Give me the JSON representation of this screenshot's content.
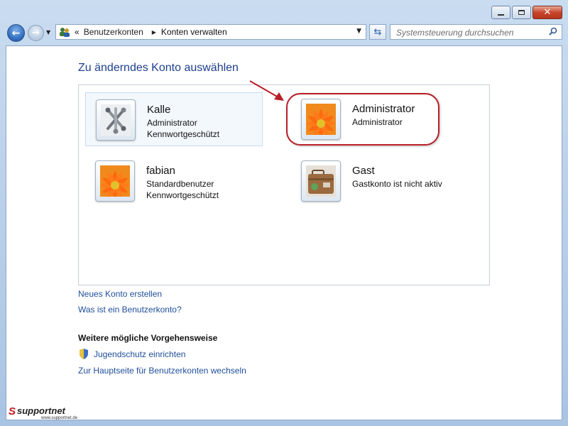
{
  "window": {
    "controls": {
      "minimize": "minimize",
      "maximize": "maximize",
      "close": "close"
    }
  },
  "navbar": {
    "breadcrumb_prefix": "«",
    "breadcrumb": [
      "Benutzerkonten",
      "Konten verwalten"
    ],
    "search_placeholder": "Systemsteuerung durchsuchen"
  },
  "main": {
    "title": "Zu änderndes Konto auswählen",
    "accounts": [
      {
        "name": "Kalle",
        "lines": [
          "Administrator",
          "Kennwortgeschützt"
        ],
        "picture": "jacks-icon",
        "selected": true
      },
      {
        "name": "Administrator",
        "lines": [
          "Administrator"
        ],
        "picture": "flower-icon",
        "highlighted": true
      },
      {
        "name": "fabian",
        "lines": [
          "Standardbenutzer",
          "Kennwortgeschützt"
        ],
        "picture": "flower-icon"
      },
      {
        "name": "Gast",
        "lines": [
          "Gastkonto ist nicht aktiv"
        ],
        "picture": "suitcase-icon"
      }
    ],
    "links": {
      "new_account": "Neues Konto erstellen",
      "what_is": "Was ist ein Benutzerkonto?"
    },
    "further": {
      "heading": "Weitere mögliche Vorgehensweise",
      "parental": "Jugendschutz einrichten",
      "mainpage": "Zur Hauptseite für Benutzerkonten wechseln"
    }
  },
  "watermark": {
    "brand": "supportnet",
    "url": "www.supportnet.de"
  },
  "colors": {
    "link": "#1f4e9b",
    "title": "#1e3f8c",
    "annotation": "#b81e26"
  }
}
